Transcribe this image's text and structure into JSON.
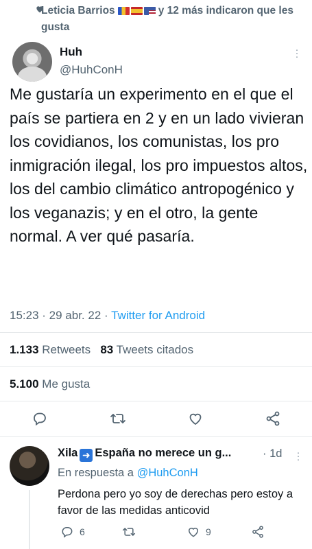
{
  "context": {
    "name": "Leticia Barrios",
    "rest": "y 12 más indicaron que les gusta",
    "flags": [
      "#f2c12e",
      "#d32f2f",
      "#3c5aa6"
    ]
  },
  "tweet": {
    "display_name": "Huh",
    "handle": "@HuhConH",
    "text": "Me gustaría un experimento en el que el país se partiera en 2 y en un lado vivieran los covidianos, los comunistas, los pro inmigración ilegal, los pro impuestos altos, los del cambio climático antropogénico y los veganazis; y en el otro, la gente normal. A ver qué pasaría.",
    "time": "15:23",
    "date": "29 abr. 22",
    "source": "Twitter for Android",
    "retweets_count": "1.133",
    "retweets_label": "Retweets",
    "quotes_count": "83",
    "quotes_label": "Tweets citados",
    "likes_count": "5.100",
    "likes_label": "Me gusta"
  },
  "reply": {
    "name": "Xila",
    "name_rest": "España no merece un g...",
    "time": "1d",
    "in_reply_prefix": "En respuesta a",
    "in_reply_handle": "@HuhConH",
    "text": "Perdona pero yo soy de derechas pero estoy a favor de las medidas anticovid",
    "replies": "6",
    "likes": "9"
  },
  "colors": {
    "accent": "#1d9bf0",
    "secondary_text": "#536471",
    "divider": "#e6e9eb"
  }
}
